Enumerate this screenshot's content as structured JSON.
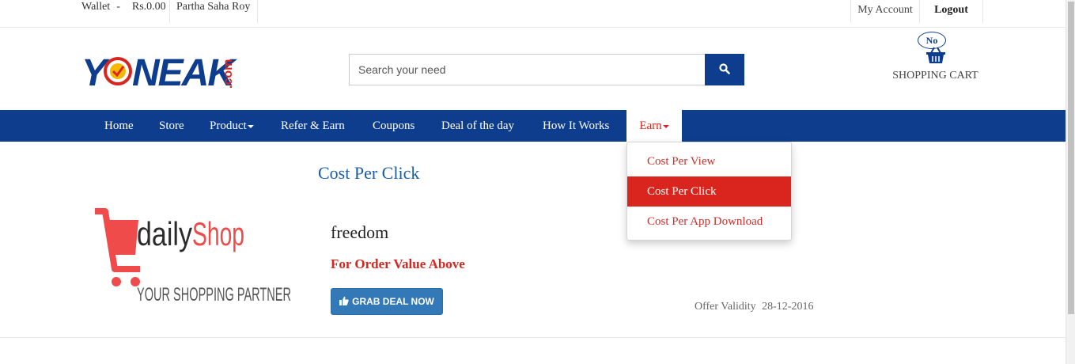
{
  "topbar": {
    "wallet_label": "Wallet",
    "wallet_dash": "-",
    "wallet_amount": "Rs.0.00",
    "user_name": "Partha Saha Roy",
    "my_account": "My Account",
    "logout": "Logout"
  },
  "header": {
    "logo_text": "YONEAK",
    "logo_suffix": ".com",
    "search_placeholder": "Search your need",
    "search_icon": "search-icon",
    "cart_badge": "No",
    "cart_label": "SHOPPING CART"
  },
  "nav": {
    "items": [
      {
        "label": "Home"
      },
      {
        "label": "Store"
      },
      {
        "label": "Product"
      },
      {
        "label": "Refer & Earn"
      },
      {
        "label": "Coupons"
      },
      {
        "label": "Deal of the day"
      },
      {
        "label": "How It Works"
      },
      {
        "label": "Earn"
      }
    ]
  },
  "dropdown": {
    "items": [
      {
        "label": "Cost Per View"
      },
      {
        "label": "Cost Per Click"
      },
      {
        "label": "Cost Per App Download"
      }
    ]
  },
  "main": {
    "page_title": "Cost Per Click",
    "shop_logo_text": "dailyShop",
    "shop_logo_tagline": "YOUR SHOPPING PARTNER",
    "deal_title": "freedom",
    "deal_subtitle": "For Order Value Above",
    "grab_button": "GRAB DEAL NOW",
    "validity_label": "Offer Validity",
    "validity_date": "28-12-2016"
  },
  "colors": {
    "brand_blue": "#0d3d8c",
    "accent_red": "#d9251d",
    "button_blue": "#3379b7",
    "title_blue": "#1a5ea8"
  }
}
